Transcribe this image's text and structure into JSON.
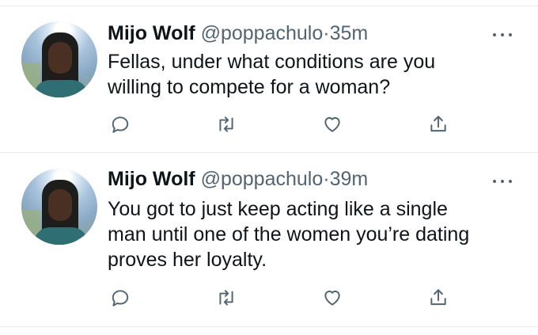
{
  "tweets": [
    {
      "name": "Mijo Wolf",
      "handle": "@poppachulo",
      "separator": "·",
      "time": "35m",
      "text": "Fellas, under what conditions are you\nwilling to compete for a woman?"
    },
    {
      "name": "Mijo Wolf",
      "handle": "@poppachulo",
      "separator": "·",
      "time": "39m",
      "text": "You got to just keep acting like a single\nman until one of the women you’re dating\nproves her loyalty."
    }
  ],
  "icons": {
    "avatar": "user-avatar",
    "more": "more-options-icon",
    "reply": "reply-icon",
    "retweet": "retweet-icon",
    "like": "heart-icon",
    "share": "share-icon"
  },
  "colors": {
    "text": "#0f1419",
    "secondary": "#536471",
    "divider": "#e6ecf0"
  }
}
